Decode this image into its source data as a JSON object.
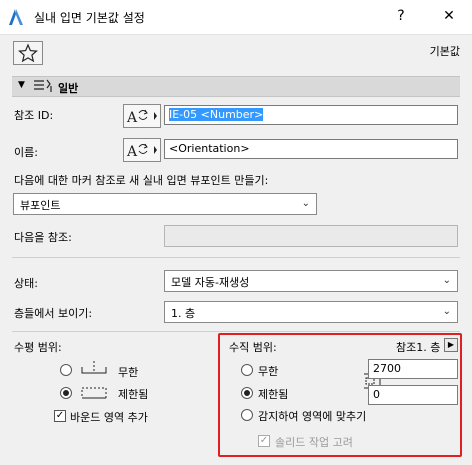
{
  "window": {
    "title": "실내 입면 기본값 설정",
    "help_label": "?",
    "close_label": "✕"
  },
  "toolbar": {
    "default_label": "기본값"
  },
  "section": {
    "title": "일반"
  },
  "form": {
    "ref_id_label": "참조 ID:",
    "ref_id_value": "IE-05 <Number>",
    "name_label": "이름:",
    "name_value": "<Orientation>",
    "marker_label": "다음에 대한 마커 참조로 새 실내 입면 뷰포인트 만들기:",
    "marker_value": "뷰포인트",
    "refer_label": "다음을 참조:",
    "refer_value": "",
    "status_label": "상태:",
    "status_value": "모델 자동-재생성",
    "show_on_stories_label": "층들에서 보이기:",
    "show_on_stories_value": "1. 층"
  },
  "horizontal_range": {
    "title": "수평 범위:",
    "infinite_label": "무한",
    "limited_label": "제한됨",
    "add_bound_label": "바운드 영역 추가"
  },
  "vertical_range": {
    "title": "수직 범위:",
    "ref_story_label": "참조1. 층",
    "infinite_label": "무한",
    "limited_label": "제한됨",
    "fit_label": "감지하여 영역에 맞추기",
    "solid_label": "솔리드 작업 고려",
    "upper_value": "2700",
    "lower_value": "0"
  }
}
